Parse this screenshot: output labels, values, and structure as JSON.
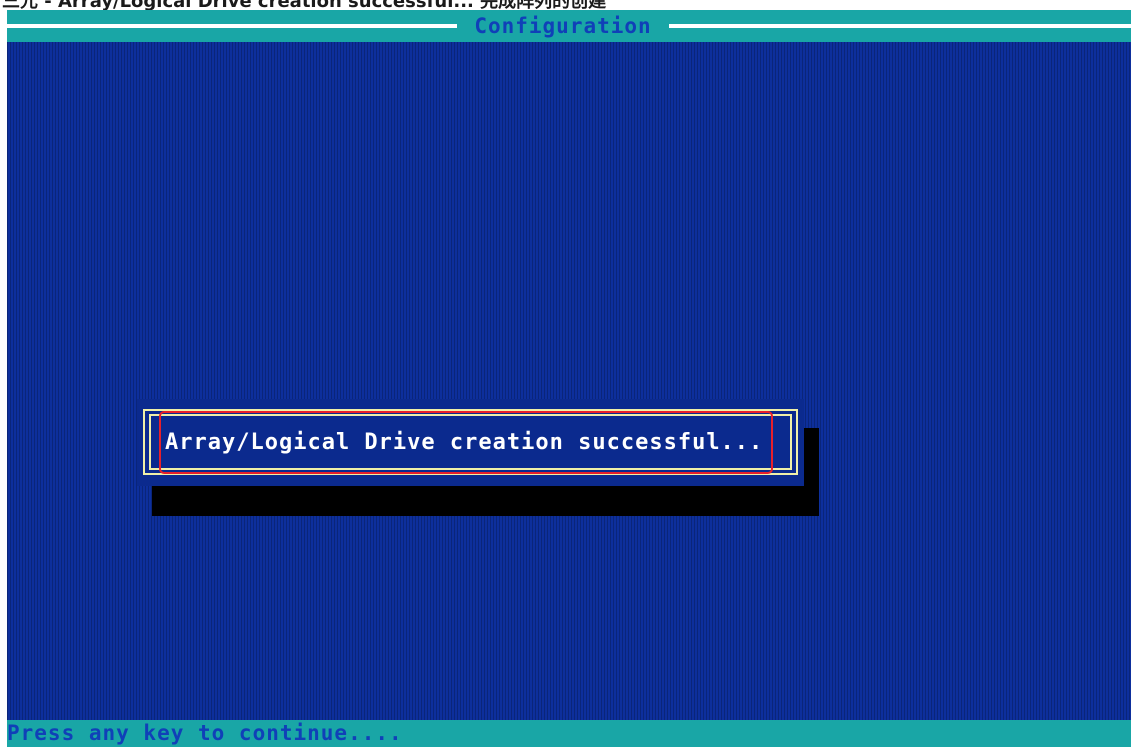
{
  "caption": {
    "text": "三元 - Array/Logical Drive creation successful... 完成阵列的创建"
  },
  "screen": {
    "title": "Configuration",
    "dialog_message": "Array/Logical Drive creation successful...",
    "status_prompt": "Press any key to continue....",
    "colors": {
      "background": "#0d2f9c",
      "bar": "#19a6a6",
      "bar_text": "#1040b8",
      "dialog_border": "#f0f0a8",
      "highlight": "#e8202a"
    }
  }
}
